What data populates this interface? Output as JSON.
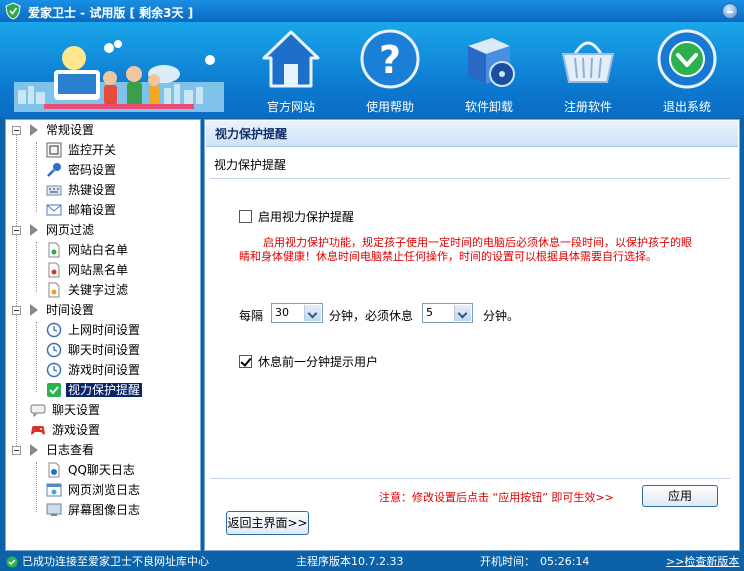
{
  "window": {
    "title": "爱家卫士 - 试用版 [ 剩余3天 ]"
  },
  "toolbar": [
    {
      "label": "官方网站",
      "icon": "home-icon"
    },
    {
      "label": "使用帮助",
      "icon": "help-icon"
    },
    {
      "label": "软件卸载",
      "icon": "uninstall-box-icon"
    },
    {
      "label": "注册软件",
      "icon": "basket-icon"
    },
    {
      "label": "退出系统",
      "icon": "exit-icon"
    }
  ],
  "tree": {
    "groups": [
      {
        "label": "常规设置",
        "items": [
          {
            "label": "监控开关",
            "icon": "monitor-switch-icon"
          },
          {
            "label": "密码设置",
            "icon": "key-icon"
          },
          {
            "label": "热键设置",
            "icon": "keyboard-icon"
          },
          {
            "label": "邮箱设置",
            "icon": "mail-icon"
          }
        ]
      },
      {
        "label": "网页过滤",
        "items": [
          {
            "label": "网站白名单",
            "icon": "whitelist-page-icon"
          },
          {
            "label": "网站黑名单",
            "icon": "blacklist-page-icon"
          },
          {
            "label": "关键字过滤",
            "icon": "keyword-page-icon"
          }
        ]
      },
      {
        "label": "时间设置",
        "items": [
          {
            "label": "上网时间设置",
            "icon": "clock-icon"
          },
          {
            "label": "聊天时间设置",
            "icon": "clock-icon"
          },
          {
            "label": "游戏时间设置",
            "icon": "clock-icon"
          },
          {
            "label": "视力保护提醒",
            "icon": "check-icon",
            "selected": true
          }
        ]
      },
      {
        "label": "聊天设置",
        "icon": "chat-icon",
        "items": []
      },
      {
        "label": "游戏设置",
        "icon": "gamepad-icon",
        "items": []
      },
      {
        "label": "日志查看",
        "items": [
          {
            "label": "QQ聊天日志",
            "icon": "qq-log-icon"
          },
          {
            "label": "网页浏览日志",
            "icon": "browser-log-icon"
          },
          {
            "label": "屏幕图像日志",
            "icon": "screen-log-icon"
          }
        ]
      }
    ]
  },
  "panel": {
    "header": "视力保护提醒",
    "group_title": "视力保护提醒",
    "enable_label": "启用视力保护提醒",
    "enable_checked": false,
    "note": "启用视力保护功能，规定孩子使用一定时间的电脑后必须休息一段时间，以保护孩子的眼睛和身体健康！休息时间电脑禁止任何操作，时间的设置可以根据具体需要自行选择。",
    "interval_prefix": "每隔",
    "interval_value": "30",
    "interval_suffix": "分钟，必须休息",
    "rest_value": "5",
    "rest_suffix": "分钟。",
    "notify_label": "休息前一分钟提示用户",
    "notify_checked": true,
    "hint": "注意：修改设置后点击 “应用按钮” 即可生效>>",
    "apply_label": "应用",
    "back_label": "返回主界面>>"
  },
  "status": {
    "connection": "已成功连接至爱家卫士不良网址库中心",
    "version": "主程序版本10.7.2.33",
    "uptime_label": "开机时间：",
    "uptime": "05:26:14",
    "update_link": ">>检查新版本"
  },
  "colors": {
    "accent_blue": "#0c62a8",
    "warning_red": "#e00000",
    "selection": "#0a246a"
  }
}
